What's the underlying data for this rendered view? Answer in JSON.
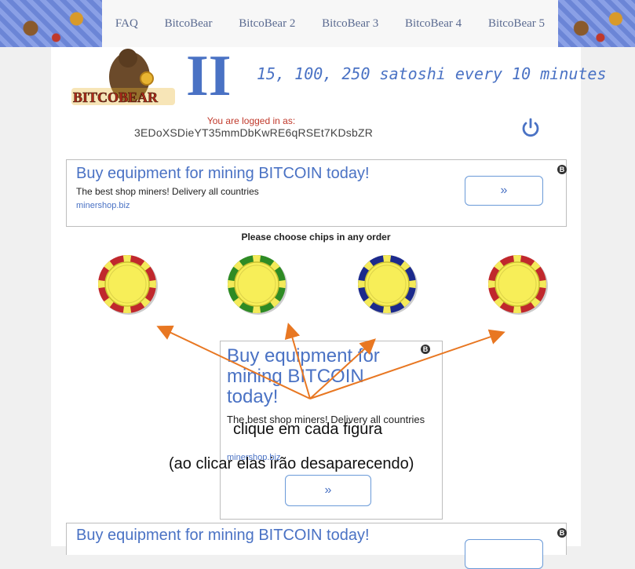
{
  "nav": {
    "links": [
      "FAQ",
      "BitcoBear",
      "BitcoBear 2",
      "BitcoBear 3",
      "BitcoBear 4",
      "BitcoBear 5"
    ]
  },
  "header": {
    "logo_text": "BITCOBEAR",
    "logo_numeral": "II",
    "tagline": "15, 100, 250 satoshi every 10 minutes",
    "logged_in_label": "You are logged in as:",
    "address": "3EDoXSDieYT35mmDbKwRE6qRSEt7KDsbZR"
  },
  "ad_top": {
    "title": "Buy equipment for mining BITCOIN today!",
    "description": "The best shop miners! Delivery all countries",
    "url": "minershop.biz",
    "button": "»",
    "badge": "B"
  },
  "game": {
    "instruction": "Please choose chips in any order",
    "chips": [
      {
        "color": "#c0282d"
      },
      {
        "color": "#2e8b24"
      },
      {
        "color": "#1c2a8c"
      },
      {
        "color": "#c0282d"
      }
    ]
  },
  "ad_middle": {
    "title": "Buy equipment for mining BITCOIN today!",
    "description": "The best shop miners! Delivery all countries",
    "url": "minershop.biz",
    "button": "»",
    "badge": "B"
  },
  "ad_bottom": {
    "title": "Buy equipment for mining BITCOIN today!",
    "badge": "B"
  },
  "annotation": {
    "line1": "clique em cada figura",
    "line2": "(ao clicar elas irão desaparecendo)",
    "color": "#e87722"
  }
}
